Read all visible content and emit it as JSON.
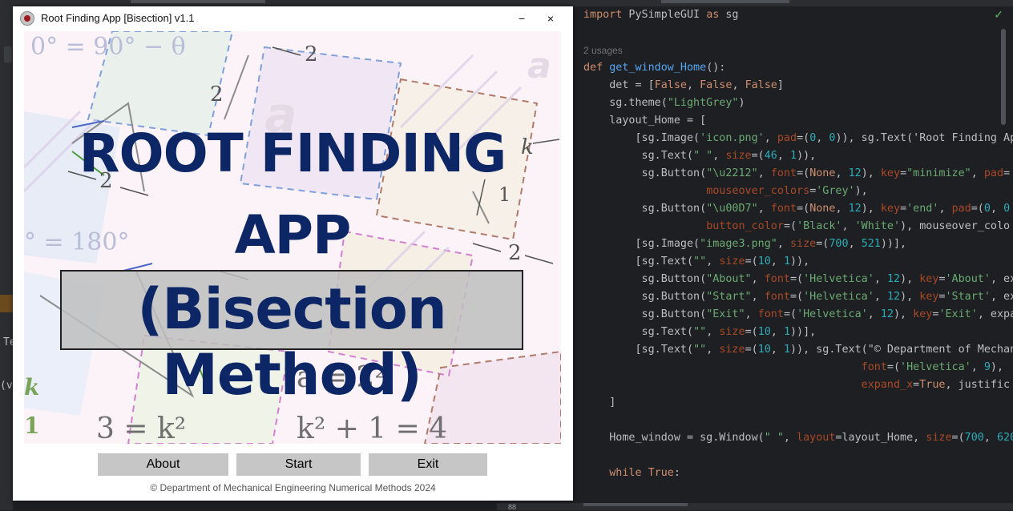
{
  "app": {
    "title": "Root Finding App [Bisection] v1.1",
    "minimize_symbol": "−",
    "close_symbol": "×"
  },
  "banner": {
    "heading_line1": "ROOT FINDING",
    "heading_line2": "APP",
    "subheading": "(Bisection Method)",
    "bg_texts": {
      "t1": "0° = 90° − θ",
      "t2": "° = 180°",
      "t3": "a = 2²",
      "t4": "3 = k²",
      "t5": "k² + 1 = 4",
      "t6": "2",
      "t7": "2",
      "t8": "2",
      "t9": "1",
      "t10": "2",
      "t11": "k",
      "t12": "k",
      "t13": "1",
      "t14": "a",
      "t15": "a"
    }
  },
  "buttons": {
    "about": "About",
    "start": "Start",
    "exit": "Exit"
  },
  "footer": "© Department of Mechanical Engineering Numerical Methods 2024",
  "editor": {
    "usages": "2 usages",
    "lines": [
      "import PySimpleGUI as sg",
      "",
      "",
      "def get_window_Home():",
      "    det = [False, False, False]",
      "    sg.theme(\"LightGrey\")",
      "    layout_Home = [",
      "        [sg.Image('icon.png', pad=(0, 0)), sg.Text('Root Finding Ap",
      "         sg.Text(\" \", size=(46, 1)),",
      "         sg.Button(\"\\u2212\", font=(None, 12), key=\"minimize\", pad=",
      "                   mouseover_colors='Grey'),",
      "         sg.Button(\"\\u00D7\", font=(None, 12), key='end', pad=(0, 0",
      "                   button_color=('Black', 'White'), mouseover_colo",
      "        [sg.Image(\"image3.png\", size=(700, 521))],",
      "        [sg.Text(\"\", size=(10, 1)),",
      "         sg.Button(\"About\", font=('Helvetica', 12), key='About', ex",
      "         sg.Button(\"Start\", font=('Helvetica', 12), key='Start', ex",
      "         sg.Button(\"Exit\", font=('Helvetica', 12), key='Exit', expa",
      "         sg.Text(\"\", size=(10, 1))],",
      "        [sg.Text(\"\", size=(10, 1)), sg.Text(\"© Department of Mechan",
      "                                           font=('Helvetica', 9),",
      "                                           expand_x=True, justific",
      "    ]",
      "",
      "    Home_window = sg.Window(\" \", layout=layout_Home, size=(700, 620",
      "",
      "    while True:"
    ],
    "check_symbol": "✓"
  },
  "ide_side": {
    "label_te": "Te",
    "label_ve": "(ve"
  },
  "colors": {
    "heading": "#0d2666",
    "button_bg": "#c6c6c6",
    "ide_bg": "#1e1f22"
  }
}
